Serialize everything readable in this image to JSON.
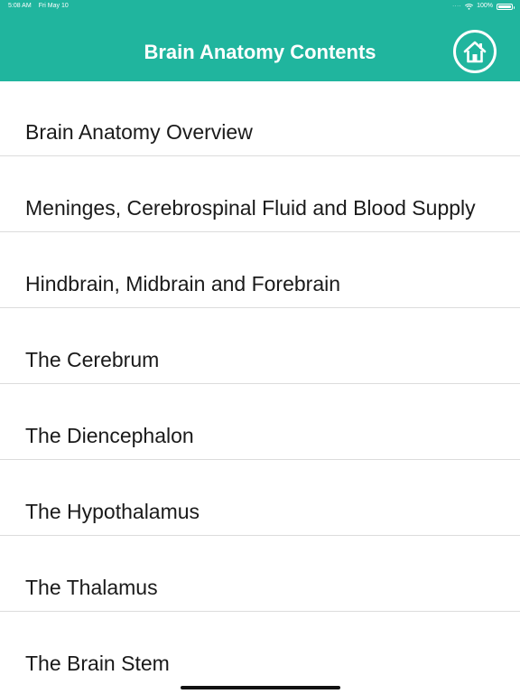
{
  "status_bar": {
    "time": "5:08 AM",
    "date": "Fri May 10",
    "battery": "100%"
  },
  "header": {
    "title": "Brain Anatomy Contents"
  },
  "home_icon": "home-icon",
  "contents": [
    {
      "label": "Brain Anatomy Overview"
    },
    {
      "label": "Meninges, Cerebrospinal Fluid and Blood Supply"
    },
    {
      "label": "Hindbrain, Midbrain and Forebrain"
    },
    {
      "label": "The Cerebrum"
    },
    {
      "label": "The Diencephalon"
    },
    {
      "label": "The Hypothalamus"
    },
    {
      "label": "The Thalamus"
    },
    {
      "label": "The Brain Stem"
    }
  ],
  "colors": {
    "header_bg": "#20b59e",
    "text": "#1a1a1a",
    "divider": "#dcdcdc"
  }
}
